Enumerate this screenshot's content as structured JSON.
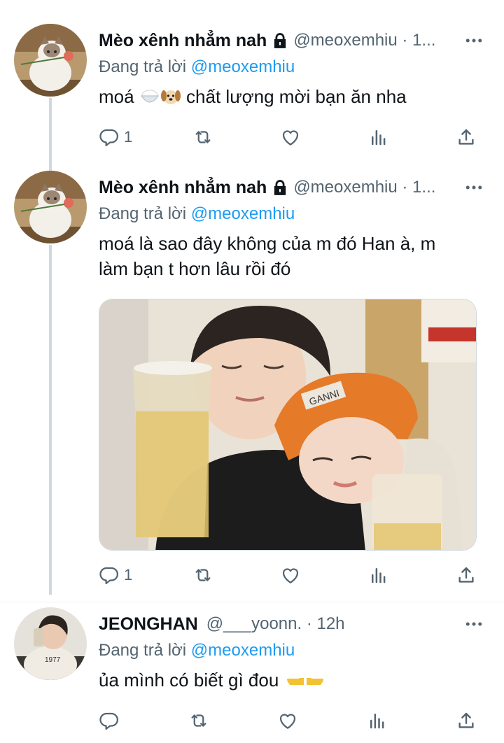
{
  "tweets": [
    {
      "author_name": "Mèo xênh nhẳm nah",
      "handle": "@meoxemhiu · 1...",
      "replying_prefix": "Đang trả lời ",
      "replying_to": "@meoxemhiu",
      "text": "moá",
      "text_after_emoji": "chất lượng mời bạn ăn nha",
      "reply_count": "1",
      "retweet_count": "",
      "like_count": ""
    },
    {
      "author_name": "Mèo xênh nhẳm nah",
      "handle": "@meoxemhiu · 1...",
      "replying_prefix": "Đang trả lời ",
      "replying_to": "@meoxemhiu",
      "text": "moá là sao đây không của m đó Han à, m làm bạn t hơn lâu rồi đó",
      "reply_count": "1",
      "retweet_count": "",
      "like_count": "",
      "media_caption": "GANNI"
    },
    {
      "author_name": "JEONGHAN",
      "handle": "@___yoonn. · 12h",
      "replying_prefix": "Đang trả lời ",
      "replying_to": "@meoxemhiu",
      "text": "ủa mình có biết gì đou",
      "reply_count": "",
      "retweet_count": "",
      "like_count": "",
      "avatar_text": "1977"
    }
  ],
  "colors": {
    "link": "#1d9bf0",
    "secondary": "#536471",
    "primary": "#0f1419",
    "thread_line": "#cfd9de"
  },
  "icons": [
    "lock-icon",
    "more-icon",
    "reply-icon",
    "retweet-icon",
    "like-icon",
    "views-icon",
    "share-icon",
    "rice-emoji",
    "dog-emoji",
    "pointing-hands-emoji"
  ]
}
